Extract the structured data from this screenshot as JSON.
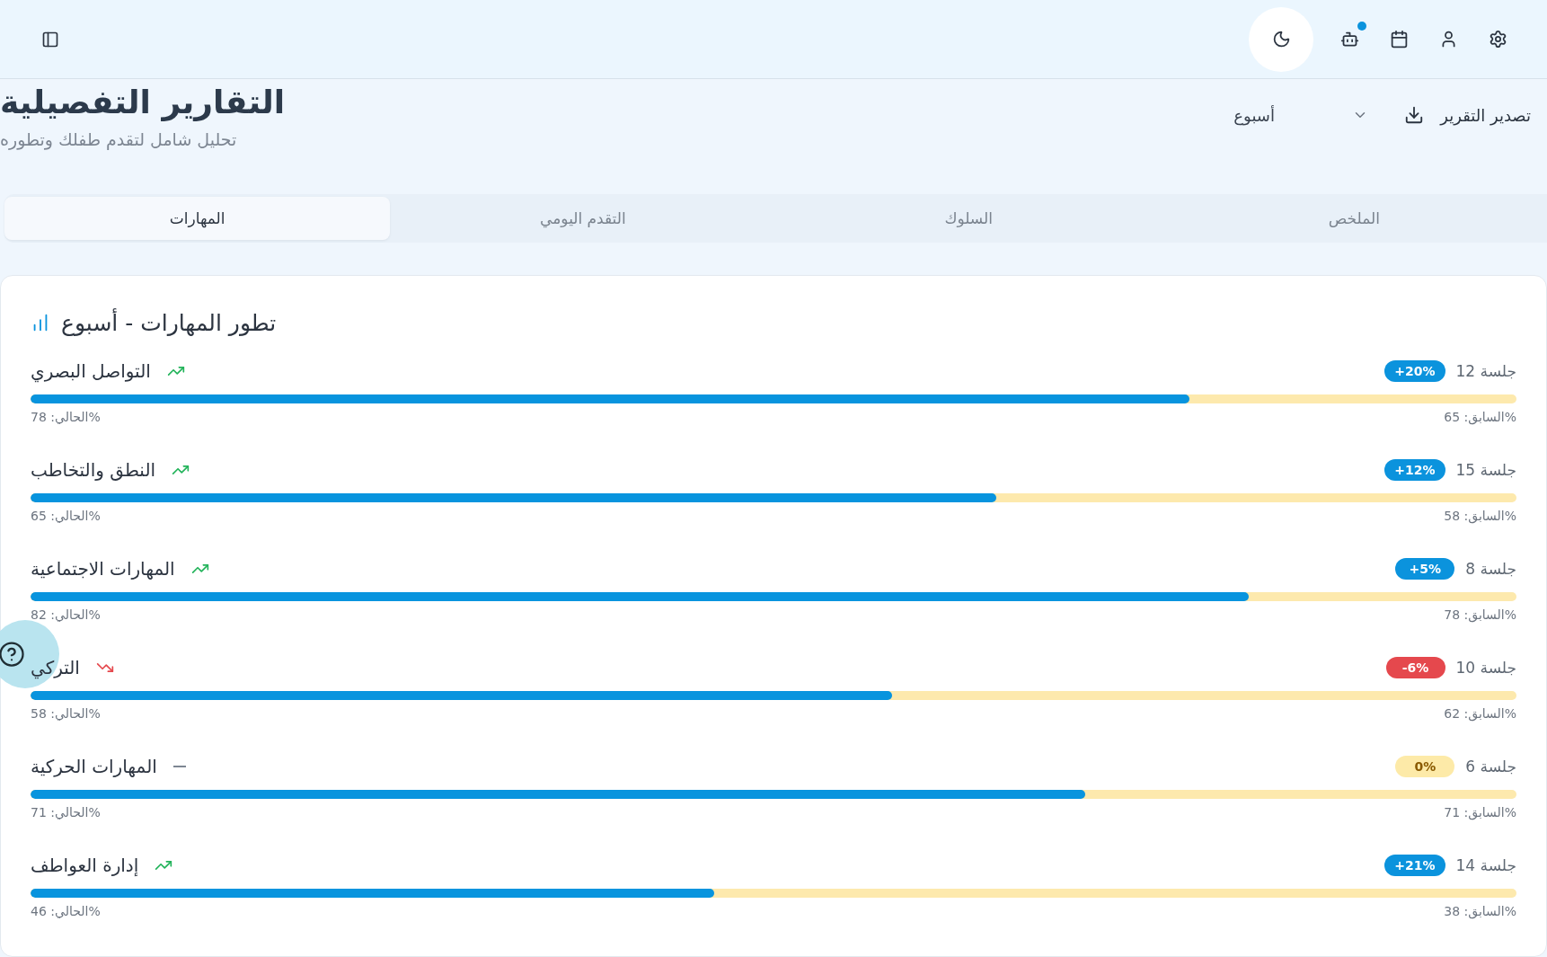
{
  "top_bar": {
    "assistant_notification": true
  },
  "header": {
    "title": "التقارير التفصيلية",
    "subtitle": "تحليل شامل لتقدم طفلك وتطوره",
    "period_select": {
      "value": "أسبوع"
    },
    "export_button": "تصدير التقرير"
  },
  "tabs": [
    {
      "label": "الملخص",
      "selected": false
    },
    {
      "label": "السلوك",
      "selected": false
    },
    {
      "label": "التقدم اليومي",
      "selected": false
    },
    {
      "label": "المهارات",
      "selected": true
    }
  ],
  "skills_card": {
    "title": "تطور المهارات - أسبوع",
    "skills": [
      {
        "name": "التواصل البصري",
        "kind": "up",
        "sessions": "جلسة 12",
        "change": "+20%",
        "level": 0.78,
        "current": "%الحالي: 78",
        "previous": "%السابق: 65"
      },
      {
        "name": "النطق والتخاطب",
        "kind": "up",
        "sessions": "جلسة 15",
        "change": "+12%",
        "level": 0.65,
        "current": "%الحالي: 65",
        "previous": "%السابق: 58"
      },
      {
        "name": "المهارات الاجتماعية",
        "kind": "up",
        "sessions": "جلسة 8",
        "change": "+5%",
        "level": 0.82,
        "current": "%الحالي: 82",
        "previous": "%السابق: 78"
      },
      {
        "name": "التركي",
        "kind": "down",
        "sessions": "جلسة 10",
        "change": "-6%",
        "level": 0.58,
        "current": "%الحالي: 58",
        "previous": "%السابق: 62"
      },
      {
        "name": "المهارات الحركية",
        "kind": "flat",
        "sessions": "جلسة 6",
        "change": "0%",
        "level": 0.71,
        "current": "%الحالي: 71",
        "previous": "%السابق: 71"
      },
      {
        "name": "إدارة العواطف",
        "kind": "up",
        "sessions": "جلسة 14",
        "change": "+21%",
        "level": 0.46,
        "current": "%الحالي: 46",
        "previous": "%السابق: 38"
      }
    ]
  }
}
